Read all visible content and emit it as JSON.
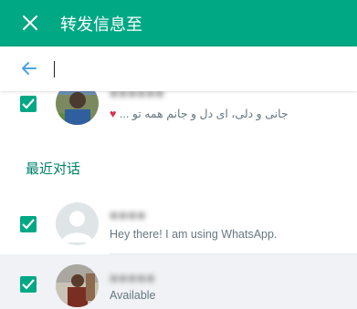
{
  "header": {
    "title": "转发信息至"
  },
  "search": {
    "value": "",
    "placeholder": ""
  },
  "section": {
    "recent_label": "最近对话"
  },
  "contacts": [
    {
      "name": "■■■■■■",
      "status_emoji": "♥",
      "status_text": "... جانی و دلی، ای دل و جانم همه تو",
      "checked": true
    },
    {
      "name": "■■■■",
      "status_text": "Hey there! I am using WhatsApp.",
      "checked": true
    },
    {
      "name": "■■■■■",
      "status_text": "Available",
      "checked": true
    }
  ],
  "colors": {
    "header": "#00a884",
    "accent": "#008069",
    "selected_row": "#f0f2f5"
  }
}
